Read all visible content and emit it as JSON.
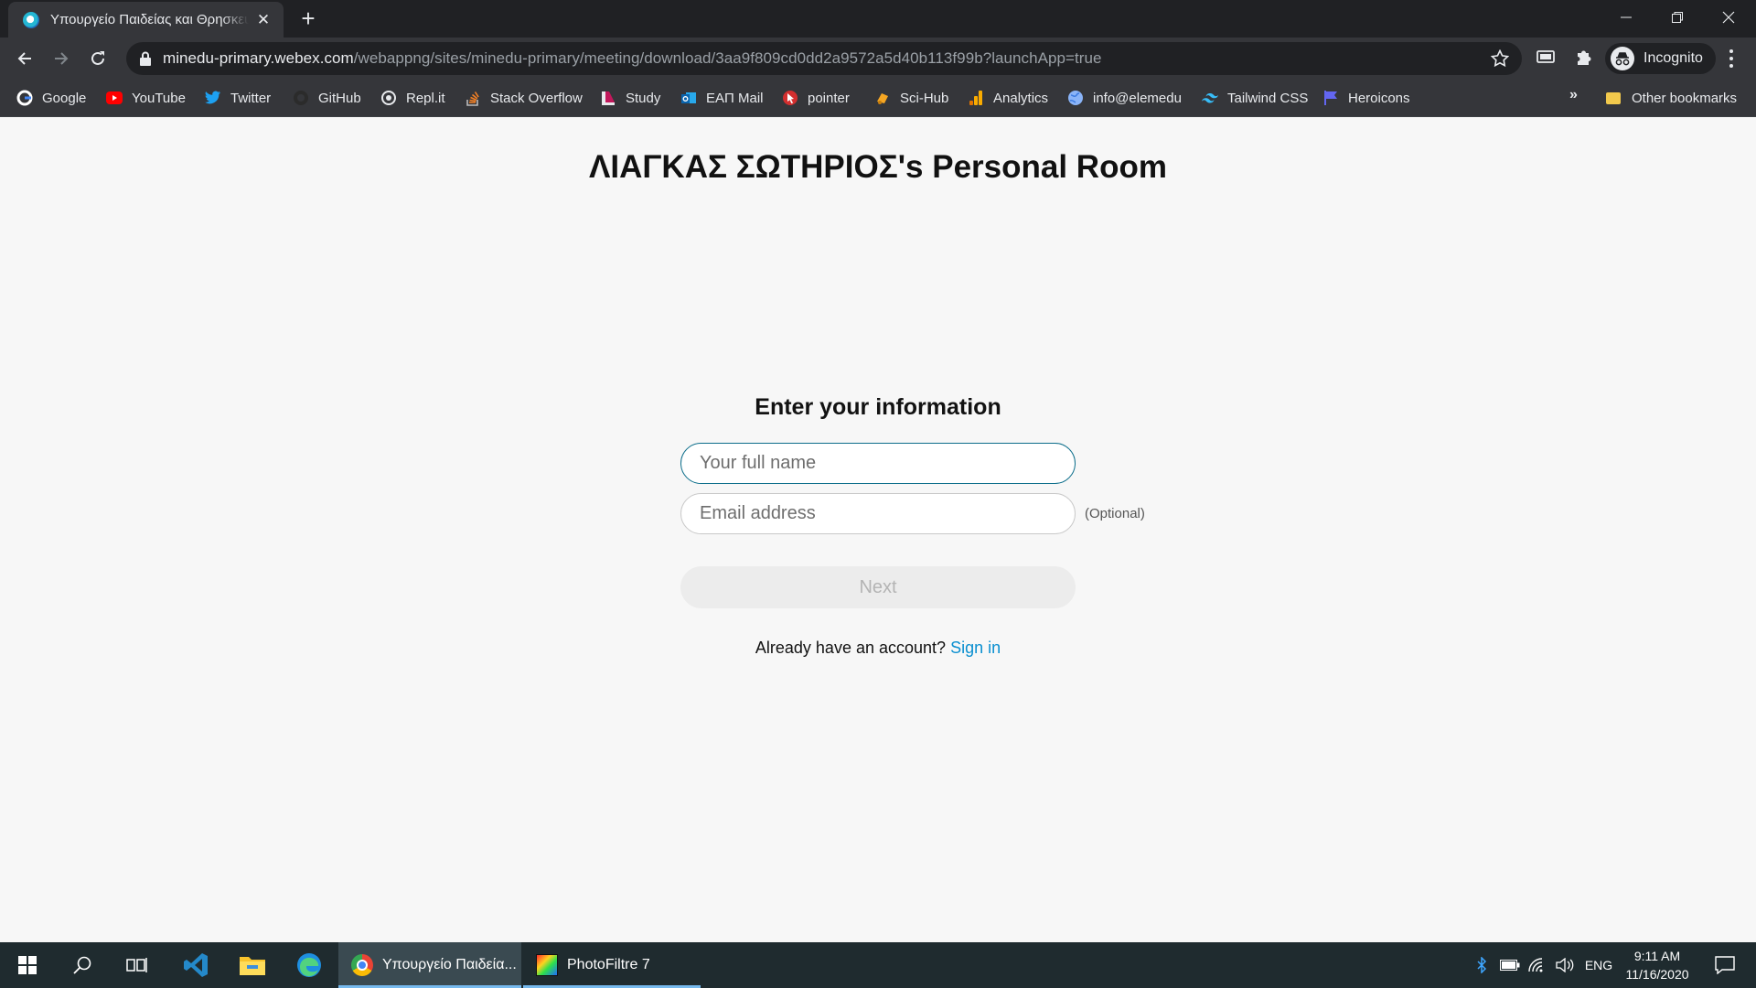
{
  "browser": {
    "tab": {
      "title": "Υπουργείο Παιδείας και Θρησκευμάτων",
      "favicon": "webex-icon"
    },
    "address": {
      "host": "minedu-primary.webex.com",
      "path": "/webappng/sites/minedu-primary/meeting/download/3aa9f809cd0dd2a9572a5d40b113f99b?launchApp=true"
    },
    "profile_label": "Incognito",
    "bookmarks": [
      {
        "label": "Google",
        "icon": "google-icon"
      },
      {
        "label": "YouTube",
        "icon": "youtube-icon"
      },
      {
        "label": "Twitter",
        "icon": "twitter-icon"
      },
      {
        "label": "GitHub",
        "icon": "github-icon"
      },
      {
        "label": "Repl.it",
        "icon": "replit-icon"
      },
      {
        "label": "Stack Overflow",
        "icon": "stackoverflow-icon"
      },
      {
        "label": "Study",
        "icon": "study-icon"
      },
      {
        "label": "ΕΑΠ Mail",
        "icon": "outlook-icon"
      },
      {
        "label": "pointer",
        "icon": "pointer-icon"
      },
      {
        "label": "Sci-Hub",
        "icon": "scihub-icon"
      },
      {
        "label": "Analytics",
        "icon": "analytics-icon"
      },
      {
        "label": "info@elemedu",
        "icon": "globe-icon"
      },
      {
        "label": "Tailwind CSS",
        "icon": "tailwind-icon"
      },
      {
        "label": "Heroicons",
        "icon": "heroicons-icon"
      }
    ],
    "bookmarks_overflow": "»",
    "other_bookmarks": "Other bookmarks"
  },
  "page": {
    "room_title": "ΛΙΑΓΚΑΣ ΣΩΤΗΡΙΟΣ's Personal Room",
    "form_heading": "Enter your information",
    "name_placeholder": "Your full name",
    "email_placeholder": "Email address",
    "optional_label": "(Optional)",
    "next_label": "Next",
    "signin_prompt": "Already have an account?",
    "signin_link": "Sign in"
  },
  "taskbar": {
    "apps": [
      {
        "label": "Υπουργείο Παιδεία...",
        "icon": "chrome-icon",
        "active": true
      },
      {
        "label": "PhotoFiltre 7",
        "icon": "photofiltre-icon",
        "active": false
      }
    ],
    "language": "ENG",
    "time": "9:11 AM",
    "date": "11/16/2020"
  },
  "colors": {
    "chrome_dark": "#202124",
    "chrome_toolbar": "#35363a",
    "page_bg": "#f7f7f7",
    "input_focus_border": "#0b6d8a",
    "link": "#0a8fd0",
    "taskbar_bg": "#1f2b2f"
  }
}
